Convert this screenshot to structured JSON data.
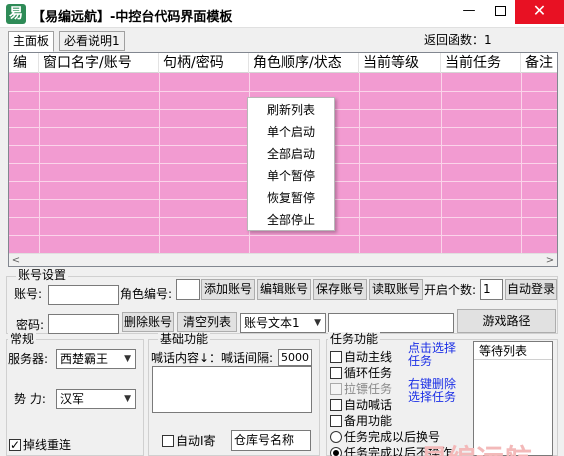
{
  "window": {
    "icon_glyph": "易",
    "title": "【易编远航】-中控台代码界面模板",
    "minimize_glyph": "—",
    "close_glyph": "✕"
  },
  "tabs": [
    {
      "label": "主面板",
      "active": true
    },
    {
      "label": "必看说明1",
      "active": false
    }
  ],
  "return_count": "返回函数：1",
  "table": {
    "columns": [
      "编",
      "窗口名字/账号",
      "句柄/密码",
      "角色顺序/状态",
      "当前等级",
      "当前任务",
      "备注"
    ],
    "row_color": "#f29bd1"
  },
  "context_menu": [
    "刷新列表",
    "单个启动",
    "全部启动",
    "单个暂停",
    "恢复暂停",
    "全部停止"
  ],
  "account": {
    "group_title": "账号设置",
    "account_label": "账号:",
    "account_value": "",
    "role_number_label": "角色编号:",
    "role_number_value": "",
    "add_button": "添加账号",
    "edit_button": "编辑账号",
    "save_button": "保存账号",
    "read_button": "读取账号",
    "open_count_label": "开启个数:",
    "open_count_value": "1",
    "auto_login_button": "自动登录",
    "password_label": "密码:",
    "password_value": "",
    "delete_button": "删除账号",
    "clear_button": "清空列表",
    "account_file_select": "账号文本1",
    "path_value": "",
    "game_path_button": "游戏路径"
  },
  "general": {
    "group_title": "常规",
    "server_label": "服务器:",
    "server_value": "西楚霸王",
    "faction_label": "势 力:",
    "faction_value": "汉军",
    "reconnect_label": "掉线重连",
    "reconnect_checked": true
  },
  "basic": {
    "group_title": "基础功能",
    "shout_label": "喊话内容↓：喊话间隔:",
    "shout_interval": "5000",
    "auto_send_label": "自动I寄",
    "warehouse_placeholder": "仓库号名称"
  },
  "tasks": {
    "group_title": "任务功能",
    "items": [
      {
        "label": "自动主线",
        "checked": false,
        "disabled": false
      },
      {
        "label": "循环任务",
        "checked": false,
        "disabled": false
      },
      {
        "label": "拉镖任务",
        "checked": false,
        "disabled": true
      },
      {
        "label": "自动喊话",
        "checked": false,
        "disabled": false
      },
      {
        "label": "备用功能",
        "checked": false,
        "disabled": false
      }
    ],
    "radios": [
      {
        "label": "任务完成以后换号",
        "selected": false
      },
      {
        "label": "任务完成以后不操作",
        "selected": true
      }
    ],
    "hint_click_select": "点击选择任务",
    "hint_right_delete": "右键删除选择任务",
    "wait_list_header": "等待列表"
  },
  "watermark": "易编远航"
}
